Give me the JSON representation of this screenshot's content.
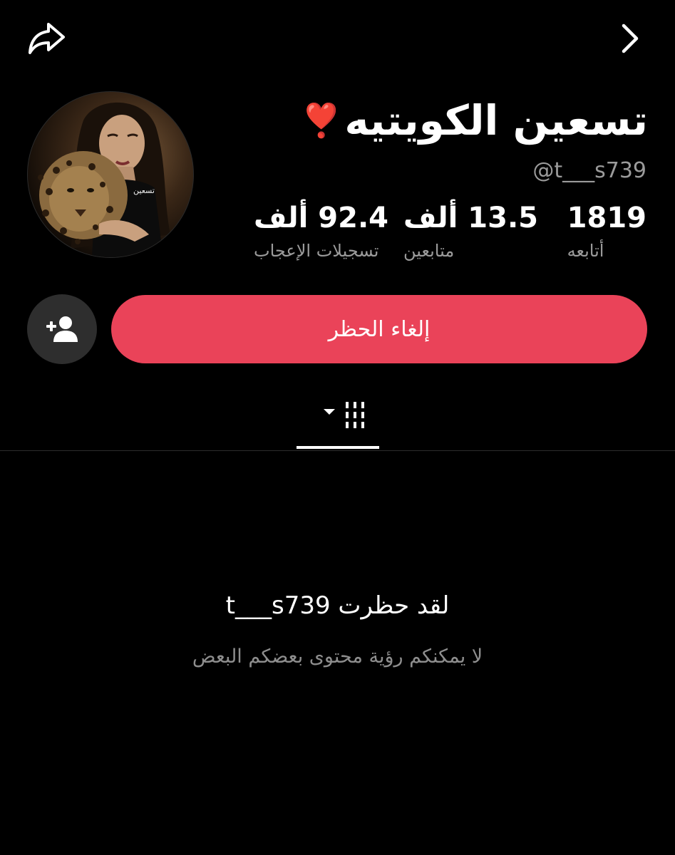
{
  "header": {
    "share_icon": "share-arrow-icon",
    "back_icon": "chevron-right-icon"
  },
  "profile": {
    "display_name": "تسعين الكويتيه",
    "name_emoji": "❣️",
    "username": "@t___s739",
    "avatar_signature": "تسعين",
    "stats": [
      {
        "value": "1819",
        "label": "أتابعه"
      },
      {
        "value": "13.5 ألف",
        "label": "متابعين"
      },
      {
        "value": "92.4 ألف",
        "label": "تسجيلات الإعجاب"
      }
    ]
  },
  "actions": {
    "unblock_label": "إلغاء الحظر",
    "add_friend_icon": "person-add-icon",
    "button_color": "#ea4359"
  },
  "tabs": {
    "active_tab_icon": "videos-grid-icon"
  },
  "blocked": {
    "title": "لقد حظرت t___s739",
    "subtitle": "لا يمكنكم رؤية محتوى بعضكم البعض"
  }
}
